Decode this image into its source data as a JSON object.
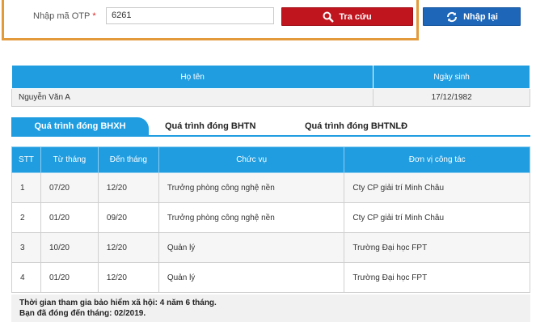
{
  "otp": {
    "label": "Nhập mã OTP",
    "required_mark": "*",
    "value": "6261"
  },
  "buttons": {
    "search_label": "Tra cứu",
    "reset_label": "Nhập lại",
    "search_icon": "search-icon",
    "reset_icon": "refresh-icon"
  },
  "person": {
    "headers": [
      "Họ tên",
      "Ngày sinh"
    ],
    "name": "Nguyễn Văn A",
    "dob": "17/12/1982"
  },
  "tabs": [
    {
      "label": "Quá trình đóng BHXH",
      "active": true
    },
    {
      "label": "Quá trình đóng BHTN",
      "active": false
    },
    {
      "label": "Quá trình đóng BHTNLĐ",
      "active": false
    }
  ],
  "history": {
    "headers": [
      "STT",
      "Từ tháng",
      "Đến tháng",
      "Chức vụ",
      "Đơn vị công tác"
    ],
    "rows": [
      [
        "1",
        "07/20",
        "12/20",
        "Trưởng phòng công nghệ nền",
        "Cty CP giải trí Minh Châu"
      ],
      [
        "2",
        "01/20",
        "09/20",
        "Trưởng phòng công nghệ nền",
        "Cty CP giải trí Minh Châu"
      ],
      [
        "3",
        "10/20",
        "12/20",
        "Quản lý",
        "Trường Đại học FPT"
      ],
      [
        "4",
        "01/20",
        "12/20",
        "Quản lý",
        "Trường Đại học FPT"
      ]
    ]
  },
  "summary": {
    "line1": "Thời gian tham gia bảo hiểm xã hội: 4 năm 6 tháng.",
    "line2": "Bạn đã đóng đến tháng: 02/2019."
  },
  "colors": {
    "accent_blue": "#1f9de0",
    "search_red": "#c0151f",
    "reset_blue": "#1d66b8",
    "highlight_orange": "#e39a3b"
  }
}
